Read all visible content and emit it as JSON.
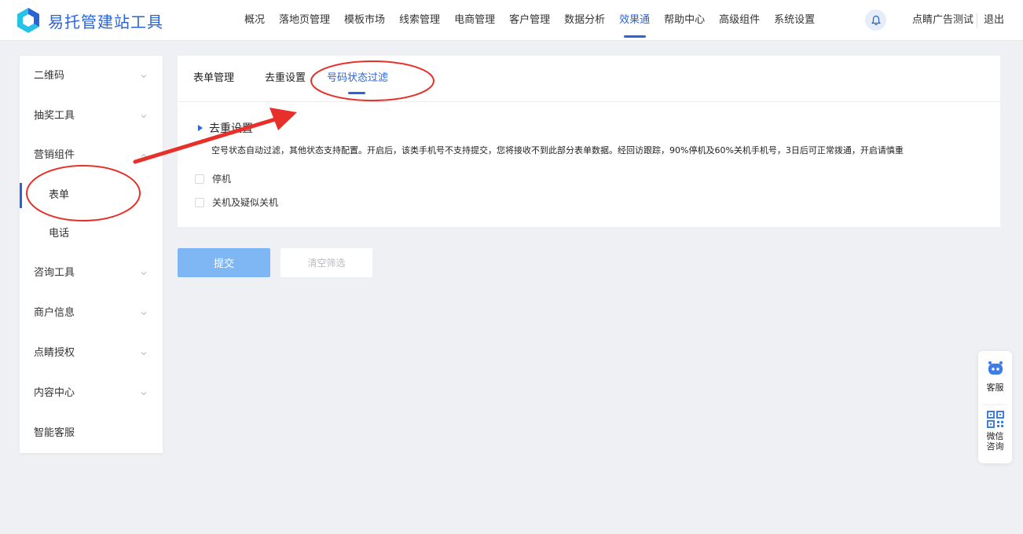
{
  "header": {
    "logo_text": "易托管建站工具",
    "nav": [
      {
        "label": "概况"
      },
      {
        "label": "落地页管理"
      },
      {
        "label": "模板市场"
      },
      {
        "label": "线索管理"
      },
      {
        "label": "电商管理"
      },
      {
        "label": "客户管理"
      },
      {
        "label": "数据分析"
      },
      {
        "label": "效果通",
        "active": true
      },
      {
        "label": "帮助中心"
      },
      {
        "label": "高级组件"
      },
      {
        "label": "系统设置"
      }
    ],
    "user_name": "点睛广告测试",
    "logout_label": "退出",
    "bell_icon": "bell-icon"
  },
  "sidebar": {
    "items": [
      {
        "label": "二维码"
      },
      {
        "label": "抽奖工具"
      },
      {
        "label": "营销组件"
      },
      {
        "label": "表单"
      },
      {
        "label": "电话"
      },
      {
        "label": "咨询工具"
      },
      {
        "label": "商户信息"
      },
      {
        "label": "点睛授权"
      },
      {
        "label": "内容中心"
      },
      {
        "label": "智能客服"
      }
    ]
  },
  "main": {
    "tabs": [
      {
        "label": "表单管理"
      },
      {
        "label": "去重设置"
      },
      {
        "label": "号码状态过滤"
      }
    ],
    "section_title": "去重设置",
    "description": "空号状态自动过滤，其他状态支持配置。开启后，该类手机号不支持提交，您将接收不到此部分表单数据。经回访跟踪，90%停机及60%关机手机号，3日后可正常拨通，开启请慎重",
    "checkboxes": [
      {
        "label": "停机",
        "checked": false
      },
      {
        "label": "关机及疑似关机",
        "checked": false
      }
    ],
    "submit_label": "提交",
    "clear_label": "清空筛选"
  },
  "float_widget": {
    "service_label": "客服",
    "wechat_label_line1": "微信",
    "wechat_label_line2": "咨询"
  },
  "colors": {
    "primary": "#2a63d8",
    "submit_bg": "#7fb7f4",
    "annotation": "#e8302a"
  }
}
